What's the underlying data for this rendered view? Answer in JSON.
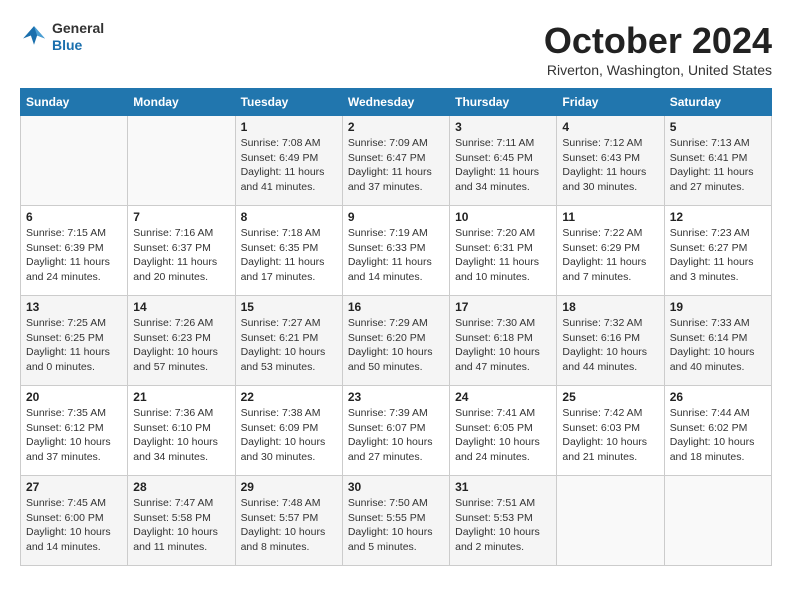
{
  "header": {
    "logo_line1": "General",
    "logo_line2": "Blue",
    "month_year": "October 2024",
    "location": "Riverton, Washington, United States"
  },
  "weekdays": [
    "Sunday",
    "Monday",
    "Tuesday",
    "Wednesday",
    "Thursday",
    "Friday",
    "Saturday"
  ],
  "weeks": [
    [
      {
        "day": "",
        "detail": ""
      },
      {
        "day": "",
        "detail": ""
      },
      {
        "day": "1",
        "detail": "Sunrise: 7:08 AM\nSunset: 6:49 PM\nDaylight: 11 hours and 41 minutes."
      },
      {
        "day": "2",
        "detail": "Sunrise: 7:09 AM\nSunset: 6:47 PM\nDaylight: 11 hours and 37 minutes."
      },
      {
        "day": "3",
        "detail": "Sunrise: 7:11 AM\nSunset: 6:45 PM\nDaylight: 11 hours and 34 minutes."
      },
      {
        "day": "4",
        "detail": "Sunrise: 7:12 AM\nSunset: 6:43 PM\nDaylight: 11 hours and 30 minutes."
      },
      {
        "day": "5",
        "detail": "Sunrise: 7:13 AM\nSunset: 6:41 PM\nDaylight: 11 hours and 27 minutes."
      }
    ],
    [
      {
        "day": "6",
        "detail": "Sunrise: 7:15 AM\nSunset: 6:39 PM\nDaylight: 11 hours and 24 minutes."
      },
      {
        "day": "7",
        "detail": "Sunrise: 7:16 AM\nSunset: 6:37 PM\nDaylight: 11 hours and 20 minutes."
      },
      {
        "day": "8",
        "detail": "Sunrise: 7:18 AM\nSunset: 6:35 PM\nDaylight: 11 hours and 17 minutes."
      },
      {
        "day": "9",
        "detail": "Sunrise: 7:19 AM\nSunset: 6:33 PM\nDaylight: 11 hours and 14 minutes."
      },
      {
        "day": "10",
        "detail": "Sunrise: 7:20 AM\nSunset: 6:31 PM\nDaylight: 11 hours and 10 minutes."
      },
      {
        "day": "11",
        "detail": "Sunrise: 7:22 AM\nSunset: 6:29 PM\nDaylight: 11 hours and 7 minutes."
      },
      {
        "day": "12",
        "detail": "Sunrise: 7:23 AM\nSunset: 6:27 PM\nDaylight: 11 hours and 3 minutes."
      }
    ],
    [
      {
        "day": "13",
        "detail": "Sunrise: 7:25 AM\nSunset: 6:25 PM\nDaylight: 11 hours and 0 minutes."
      },
      {
        "day": "14",
        "detail": "Sunrise: 7:26 AM\nSunset: 6:23 PM\nDaylight: 10 hours and 57 minutes."
      },
      {
        "day": "15",
        "detail": "Sunrise: 7:27 AM\nSunset: 6:21 PM\nDaylight: 10 hours and 53 minutes."
      },
      {
        "day": "16",
        "detail": "Sunrise: 7:29 AM\nSunset: 6:20 PM\nDaylight: 10 hours and 50 minutes."
      },
      {
        "day": "17",
        "detail": "Sunrise: 7:30 AM\nSunset: 6:18 PM\nDaylight: 10 hours and 47 minutes."
      },
      {
        "day": "18",
        "detail": "Sunrise: 7:32 AM\nSunset: 6:16 PM\nDaylight: 10 hours and 44 minutes."
      },
      {
        "day": "19",
        "detail": "Sunrise: 7:33 AM\nSunset: 6:14 PM\nDaylight: 10 hours and 40 minutes."
      }
    ],
    [
      {
        "day": "20",
        "detail": "Sunrise: 7:35 AM\nSunset: 6:12 PM\nDaylight: 10 hours and 37 minutes."
      },
      {
        "day": "21",
        "detail": "Sunrise: 7:36 AM\nSunset: 6:10 PM\nDaylight: 10 hours and 34 minutes."
      },
      {
        "day": "22",
        "detail": "Sunrise: 7:38 AM\nSunset: 6:09 PM\nDaylight: 10 hours and 30 minutes."
      },
      {
        "day": "23",
        "detail": "Sunrise: 7:39 AM\nSunset: 6:07 PM\nDaylight: 10 hours and 27 minutes."
      },
      {
        "day": "24",
        "detail": "Sunrise: 7:41 AM\nSunset: 6:05 PM\nDaylight: 10 hours and 24 minutes."
      },
      {
        "day": "25",
        "detail": "Sunrise: 7:42 AM\nSunset: 6:03 PM\nDaylight: 10 hours and 21 minutes."
      },
      {
        "day": "26",
        "detail": "Sunrise: 7:44 AM\nSunset: 6:02 PM\nDaylight: 10 hours and 18 minutes."
      }
    ],
    [
      {
        "day": "27",
        "detail": "Sunrise: 7:45 AM\nSunset: 6:00 PM\nDaylight: 10 hours and 14 minutes."
      },
      {
        "day": "28",
        "detail": "Sunrise: 7:47 AM\nSunset: 5:58 PM\nDaylight: 10 hours and 11 minutes."
      },
      {
        "day": "29",
        "detail": "Sunrise: 7:48 AM\nSunset: 5:57 PM\nDaylight: 10 hours and 8 minutes."
      },
      {
        "day": "30",
        "detail": "Sunrise: 7:50 AM\nSunset: 5:55 PM\nDaylight: 10 hours and 5 minutes."
      },
      {
        "day": "31",
        "detail": "Sunrise: 7:51 AM\nSunset: 5:53 PM\nDaylight: 10 hours and 2 minutes."
      },
      {
        "day": "",
        "detail": ""
      },
      {
        "day": "",
        "detail": ""
      }
    ]
  ]
}
